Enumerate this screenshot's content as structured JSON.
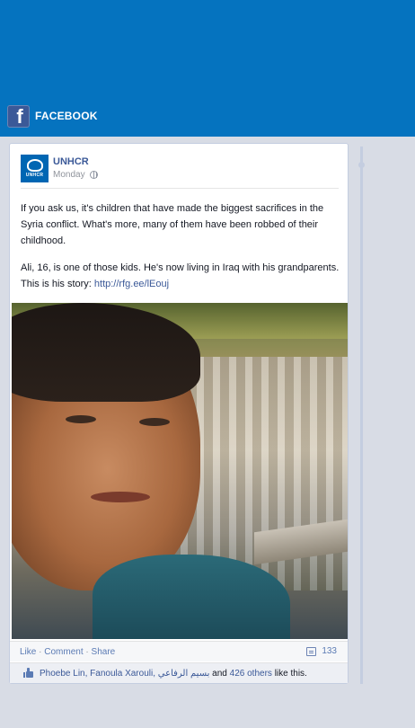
{
  "colors": {
    "banner": "#0573bf",
    "facebook_blue": "#3b5998",
    "link": "#3b5998"
  },
  "header": {
    "title": "FACEBOOK",
    "logo_icon": "facebook-logo-icon",
    "logo_letter": "f"
  },
  "post": {
    "page_name": "UNHCR",
    "avatar_icon": "unhcr-logo-icon",
    "avatar_text": "UNHCR",
    "date": "Monday",
    "audience_icon": "globe-icon",
    "text_p1": "If you ask us, it's children that have made the biggest sacrifices in the Syria conflict. What's more, many of them have been robbed of their childhood.",
    "text_p2_prefix": "Ali, 16, is one of those kids. He's now living in Iraq with his grandparents. This is his story: ",
    "text_p2_link": "http://rfg.ee/lEouj",
    "photo_description_icon": "photo-boy-refugee-camp"
  },
  "actions": {
    "like": "Like",
    "sep": "·",
    "comment": "Comment",
    "share": "Share",
    "comment_count": "133",
    "comment_icon": "comment-icon"
  },
  "likes": {
    "icon": "like-thumb-icon",
    "names": "Phoebe Lin, Fanoula Xarouli, بسيم الرفاعي",
    "and_text": " and ",
    "others": "426 others",
    "suffix": " like this."
  }
}
